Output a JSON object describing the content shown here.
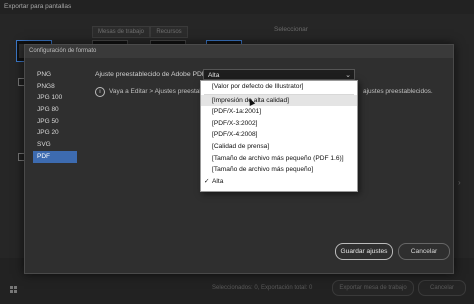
{
  "background_window": {
    "title": "Exportar para pantallas",
    "tabs": [
      "Mesas de trabajo",
      "Recursos"
    ],
    "select_label": "Seleccionar",
    "footer_status": "Seleccionados: 0, Exportación total: 0",
    "buttons": [
      "Exportar mesa de trabajo",
      "Cancelar"
    ]
  },
  "dialog": {
    "title": "Configuración de formato",
    "formats": [
      "PNG",
      "PNG8",
      "JPG 100",
      "JPG 80",
      "JPG 50",
      "JPG 20",
      "SVG",
      "PDF"
    ],
    "selected_format": "PDF",
    "preset_label": "Ajuste preestablecido de Adobe PDF:",
    "preset_value": "Alta",
    "info_text": "Vaya a Editar > Ajustes preestab",
    "info_text_right": "ajustes preestablecidos.",
    "save_button": "Guardar ajustes",
    "cancel_button": "Cancelar"
  },
  "preset_menu": {
    "items": [
      "[Valor por defecto de Illustrator]",
      "[Impresión de alta calidad]",
      "[PDF/X-1a:2001]",
      "[PDF/X-3:2002]",
      "[PDF/X-4:2008]",
      "[Calidad de prensa]",
      "[Tamaño de archivo más pequeño (PDF 1.6)]",
      "[Tamaño de archivo más pequeño]",
      "Alta"
    ],
    "checked_item": "Alta",
    "hovered_item": "[Impresión de alta calidad]",
    "checkmark": "✓"
  },
  "colors": {
    "selection_blue": "#3d6bb0",
    "dialog_bg": "#2f2f2f",
    "menu_bg": "#ffffff"
  }
}
